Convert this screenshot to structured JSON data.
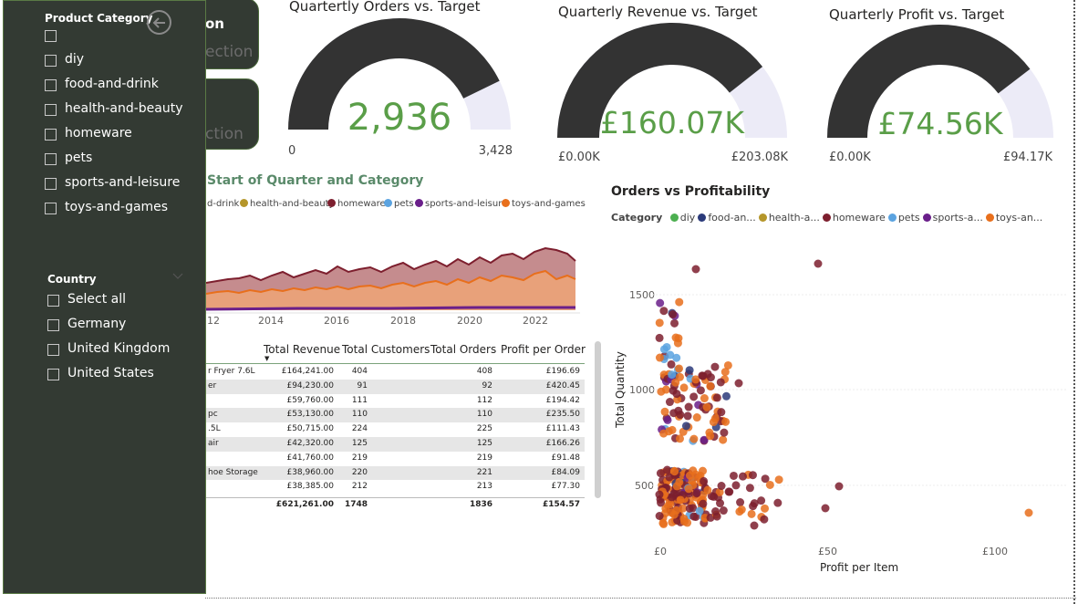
{
  "nav_buttons": [
    {
      "title": "on",
      "subtitle": "ection"
    },
    {
      "title": "",
      "subtitle": "ction"
    }
  ],
  "gauges": [
    {
      "title": "Quartertly Orders vs. Target",
      "value": "2,936",
      "min_label": "0",
      "max_label": "3,428",
      "fraction": 0.856
    },
    {
      "title": "Quarterly Revenue vs. Target",
      "value": "£160.07K",
      "min_label": "£0.00K",
      "max_label": "£203.08K",
      "fraction": 0.788
    },
    {
      "title": "Quarterly Profit vs. Target",
      "value": "£74.56K",
      "min_label": "£0.00K",
      "max_label": "£94.17K",
      "fraction": 0.792
    }
  ],
  "filter_panel": {
    "category_heading": "Product Category",
    "categories": [
      "",
      "diy",
      "food-and-drink",
      "health-and-beauty",
      "homeware",
      "pets",
      "sports-and-leisure",
      "toys-and-games"
    ],
    "country_heading": "Country",
    "countries": [
      "Select all",
      "Germany",
      "United Kingdom",
      "United States"
    ]
  },
  "area_chart": {
    "title": "Start of Quarter and Category",
    "legend": [
      {
        "label": "d-drink",
        "color": "#ffffff"
      },
      {
        "label": "health-and-beauty",
        "color": "#b5962a"
      },
      {
        "label": "homeware",
        "color": "#7d1f2e"
      },
      {
        "label": "pets",
        "color": "#5ba3e0"
      },
      {
        "label": "sports-and-leisure",
        "color": "#6a1f8a"
      },
      {
        "label": "toys-and-games",
        "color": "#e86f1c"
      }
    ],
    "x_ticks": [
      "12",
      "2014",
      "2016",
      "2018",
      "2020",
      "2022"
    ]
  },
  "table": {
    "headers": [
      "Total Revenue",
      "Total Customers",
      "Total Orders",
      "Profit per Order"
    ],
    "rows": [
      {
        "name": "r Fryer 7.6L",
        "revenue": "£164,241.00",
        "customers": "404",
        "orders": "408",
        "ppo": "£196.69"
      },
      {
        "name": "er",
        "revenue": "£94,230.00",
        "customers": "91",
        "orders": "92",
        "ppo": "£420.45"
      },
      {
        "name": "",
        "revenue": "£59,760.00",
        "customers": "111",
        "orders": "112",
        "ppo": "£194.42"
      },
      {
        "name": "pc",
        "revenue": "£53,130.00",
        "customers": "110",
        "orders": "110",
        "ppo": "£235.50"
      },
      {
        "name": ".5L",
        "revenue": "£50,715.00",
        "customers": "224",
        "orders": "225",
        "ppo": "£111.43"
      },
      {
        "name": "air",
        "revenue": "£42,320.00",
        "customers": "125",
        "orders": "125",
        "ppo": "£166.26"
      },
      {
        "name": "",
        "revenue": "£41,760.00",
        "customers": "219",
        "orders": "219",
        "ppo": "£91.48"
      },
      {
        "name": "hoe Storage",
        "revenue": "£38,960.00",
        "customers": "220",
        "orders": "221",
        "ppo": "£84.09"
      },
      {
        "name": "",
        "revenue": "£38,385.00",
        "customers": "212",
        "orders": "213",
        "ppo": "£77.30"
      }
    ],
    "total": {
      "revenue": "£621,261.00",
      "customers": "1748",
      "orders": "1836",
      "ppo": "£154.57"
    }
  },
  "scatter": {
    "title": "Orders vs Profitability",
    "legend_title": "Category",
    "legend": [
      {
        "label": "diy",
        "color": "#4caf50"
      },
      {
        "label": "food-an...",
        "color": "#2b3a7a"
      },
      {
        "label": "health-a...",
        "color": "#b5962a"
      },
      {
        "label": "homeware",
        "color": "#7d1f2e"
      },
      {
        "label": "pets",
        "color": "#5ba3e0"
      },
      {
        "label": "sports-a...",
        "color": "#6a1f8a"
      },
      {
        "label": "toys-an...",
        "color": "#e86f1c"
      }
    ],
    "x_title": "Profit per Item",
    "y_title": "Total Quantity",
    "x_ticks": [
      "£0",
      "£50",
      "£100"
    ],
    "y_ticks": [
      "1500",
      "1000",
      "500"
    ]
  },
  "colors": {
    "panel_bg": "#333a33",
    "gauge_fill": "#333333",
    "gauge_track": "#ecebf7",
    "gauge_value": "#5a9e48",
    "homeware": "#7d1f2e",
    "toys": "#e86f1c",
    "homeware_area": "#c58c8e",
    "toys_area": "#e8a17a"
  }
}
